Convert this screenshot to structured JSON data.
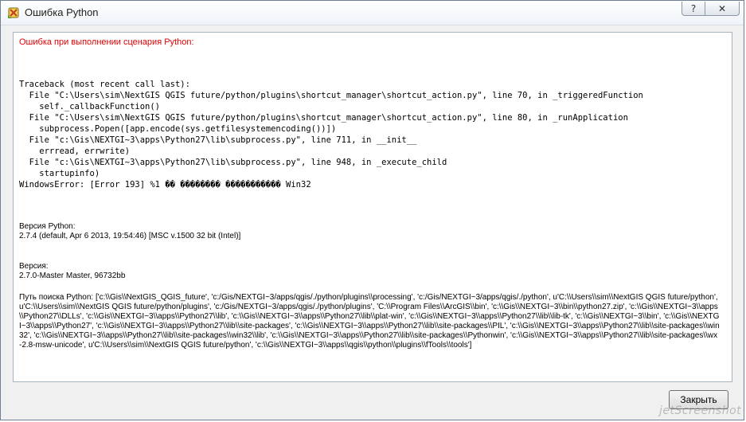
{
  "window": {
    "title": "Ошибка Python",
    "help_label": "?",
    "close_label": "✕"
  },
  "content": {
    "error_heading": "Ошибка при выполнении сценария Python:",
    "traceback": "Traceback (most recent call last):\n  File \"C:\\Users\\sim\\NextGIS QGIS future/python/plugins\\shortcut_manager\\shortcut_action.py\", line 70, in _triggeredFunction\n    self._callbackFunction()\n  File \"C:\\Users\\sim\\NextGIS QGIS future/python/plugins\\shortcut_manager\\shortcut_action.py\", line 80, in _runApplication\n    subprocess.Popen([app.encode(sys.getfilesystemencoding())])\n  File \"c:\\Gis\\NEXTGI~3\\apps\\Python27\\lib\\subprocess.py\", line 711, in __init__\n    errread, errwrite)\n  File \"c:\\Gis\\NEXTGI~3\\apps\\Python27\\lib\\subprocess.py\", line 948, in _execute_child\n    startupinfo)\nWindowsError: [Error 193] %1 �� �������� ����������� Win32",
    "python_version_label": "Версия Python:",
    "python_version_value": "2.7.4 (default, Apr  6 2013, 19:54:46) [MSC v.1500 32 bit (Intel)]",
    "version_label": "Версия:",
    "version_value": "2.7.0-Master Master, 96732bb",
    "path_text": "Путь поиска Python: ['c:\\\\Gis\\\\NextGIS_QGIS_future', 'c:/Gis/NEXTGI~3/apps/qgis/./python/plugins\\\\processing', 'c:/Gis/NEXTGI~3/apps/qgis/./python', u'C:\\\\Users\\\\sim\\\\NextGIS QGIS future/python', u'C:\\\\Users\\\\sim\\\\NextGIS QGIS future/python/plugins', 'c:/Gis/NEXTGI~3/apps/qgis/./python/plugins', 'C:\\\\Program Files\\\\ArcGIS\\\\bin', 'c:\\\\Gis\\\\NEXTGI~3\\\\bin\\\\python27.zip', 'c:\\\\Gis\\\\NEXTGI~3\\\\apps\\\\Python27\\\\DLLs', 'c:\\\\Gis\\\\NEXTGI~3\\\\apps\\\\Python27\\\\lib', 'c:\\\\Gis\\\\NEXTGI~3\\\\apps\\\\Python27\\\\lib\\\\plat-win', 'c:\\\\Gis\\\\NEXTGI~3\\\\apps\\\\Python27\\\\lib\\\\lib-tk', 'c:\\\\Gis\\\\NEXTGI~3\\\\bin', 'c:\\\\Gis\\\\NEXTGI~3\\\\apps\\\\Python27', 'c:\\\\Gis\\\\NEXTGI~3\\\\apps\\\\Python27\\\\lib\\\\site-packages', 'c:\\\\Gis\\\\NEXTGI~3\\\\apps\\\\Python27\\\\lib\\\\site-packages\\\\PIL', 'c:\\\\Gis\\\\NEXTGI~3\\\\apps\\\\Python27\\\\lib\\\\site-packages\\\\win32', 'c:\\\\Gis\\\\NEXTGI~3\\\\apps\\\\Python27\\\\lib\\\\site-packages\\\\win32\\\\lib', 'c:\\\\Gis\\\\NEXTGI~3\\\\apps\\\\Python27\\\\lib\\\\site-packages\\\\Pythonwin', 'c:\\\\Gis\\\\NEXTGI~3\\\\apps\\\\Python27\\\\lib\\\\site-packages\\\\wx-2.8-msw-unicode', u'C:\\\\Users\\\\sim\\\\NextGIS QGIS future/python', 'c:\\\\Gis\\\\NEXTGI~3\\\\apps\\\\qgis\\\\python\\\\plugins\\\\fTools\\\\tools']"
  },
  "buttons": {
    "close_dialog_label": "Закрыть"
  },
  "watermark": "jetScreenshot",
  "icons": {
    "app_icon": "qgis-python-icon"
  },
  "colors": {
    "error_text": "#e00000"
  }
}
